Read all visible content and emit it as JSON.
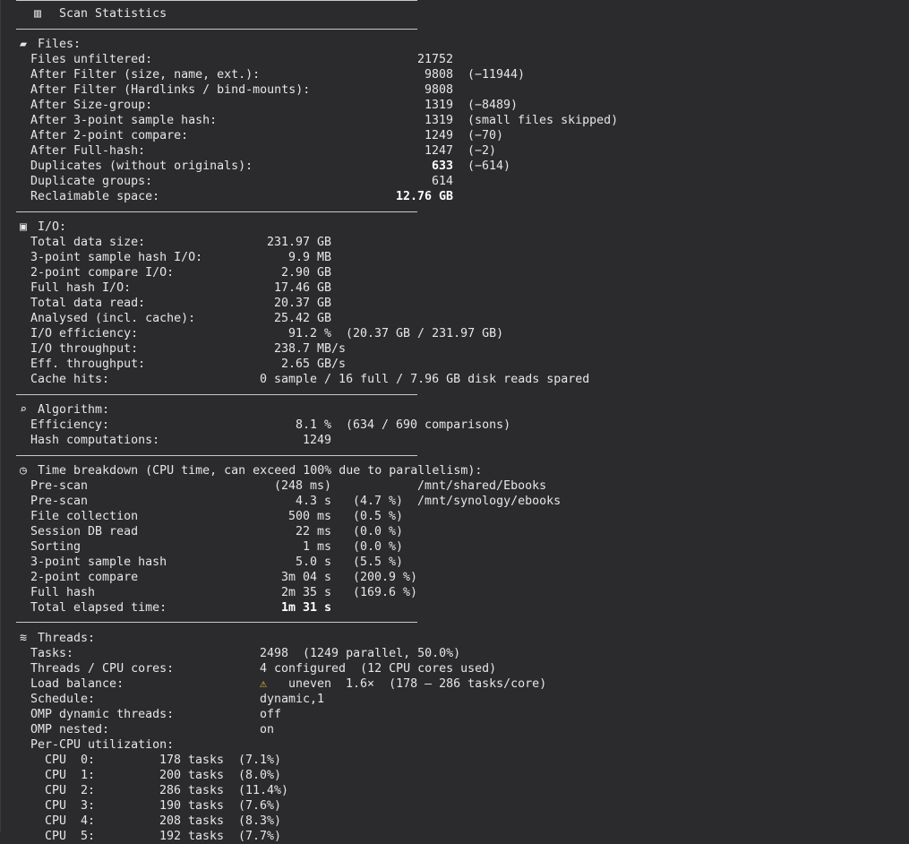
{
  "title": "Scan Statistics",
  "icons": {
    "title": "bar-chart-icon",
    "files": "folder-icon",
    "io": "floppy-disk-icon",
    "algorithm": "magnifier-icon",
    "time": "stopwatch-icon",
    "threads": "thread-spool-icon",
    "warning": "warning-icon"
  },
  "files": {
    "heading": "Files:",
    "rows": [
      {
        "label": "Files unfiltered:",
        "value": "21752",
        "note": ""
      },
      {
        "label": "After Filter (size, name, ext.):",
        "value": "9808",
        "note": "(−11944)"
      },
      {
        "label": "After Filter (Hardlinks / bind-mounts):",
        "value": "9808",
        "note": ""
      },
      {
        "label": "After Size-group:",
        "value": "1319",
        "note": "(−8489)"
      },
      {
        "label": "After 3-point sample hash:",
        "value": "1319",
        "note": "(small files skipped)"
      },
      {
        "label": "After 2-point compare:",
        "value": "1249",
        "note": "(−70)"
      },
      {
        "label": "After Full-hash:",
        "value": "1247",
        "note": "(−2)"
      },
      {
        "label": "Duplicates (without originals):",
        "value": "633",
        "note": "(−614)"
      },
      {
        "label": "Duplicate groups:",
        "value": "614",
        "note": ""
      },
      {
        "label": "Reclaimable space:",
        "value": "12.76 GB",
        "note": ""
      }
    ]
  },
  "io": {
    "heading": "I/O:",
    "rows": [
      {
        "label": "Total data size:",
        "value": "231.97 GB",
        "note": ""
      },
      {
        "label": "3-point sample hash I/O:",
        "value": "9.9 MB",
        "note": ""
      },
      {
        "label": "2-point compare I/O:",
        "value": "2.90 GB",
        "note": ""
      },
      {
        "label": "Full hash I/O:",
        "value": "17.46 GB",
        "note": ""
      },
      {
        "label": "Total data read:",
        "value": "20.37 GB",
        "note": ""
      },
      {
        "label": "Analysed (incl. cache):",
        "value": "25.42 GB",
        "note": ""
      },
      {
        "label": "I/O efficiency:",
        "value": "91.2 %",
        "note": "(20.37 GB / 231.97 GB)"
      },
      {
        "label": "I/O throughput:",
        "value": "238.7 MB/s",
        "note": ""
      },
      {
        "label": "Eff. throughput:",
        "value": "2.65 GB/s",
        "note": ""
      },
      {
        "label": "Cache hits:",
        "value": "0 sample / 16 full / 7.96 GB disk reads spared",
        "note": ""
      }
    ]
  },
  "algorithm": {
    "heading": "Algorithm:",
    "rows": [
      {
        "label": "Efficiency:",
        "value": "8.1 %",
        "note": "(634 / 690 comparisons)"
      },
      {
        "label": "Hash computations:",
        "value": "1249",
        "note": ""
      }
    ]
  },
  "time": {
    "heading": "Time breakdown (CPU time, can exceed 100% due to parallelism):",
    "rows": [
      {
        "label": "Pre-scan",
        "value": "(248 ms)",
        "note": "/mnt/shared/Ebooks"
      },
      {
        "label": "Pre-scan",
        "value": "4.3 s",
        "note": "(4.7 %)  /mnt/synology/ebooks"
      },
      {
        "label": "File collection",
        "value": "500 ms",
        "note": "(0.5 %)"
      },
      {
        "label": "Session DB read",
        "value": "22 ms",
        "note": "(0.0 %)"
      },
      {
        "label": "Sorting",
        "value": "1 ms",
        "note": "(0.0 %)"
      },
      {
        "label": "3-point sample hash",
        "value": "5.0 s",
        "note": "(5.5 %)"
      },
      {
        "label": "2-point compare",
        "value": "3m 04 s",
        "note": "(200.9 %)"
      },
      {
        "label": "Full hash",
        "value": "2m 35 s",
        "note": "(169.6 %)"
      },
      {
        "label": "Total elapsed time:",
        "value": "1m 31 s",
        "note": ""
      }
    ]
  },
  "threads": {
    "heading": "Threads:",
    "rows": [
      {
        "label": "Tasks:",
        "value": "2498  (1249 parallel, 50.0%)"
      },
      {
        "label": "Threads / CPU cores:",
        "value": "4 configured  (12 CPU cores used)"
      },
      {
        "label": "Load balance:",
        "value": "uneven  1.6×  (178 – 286 tasks/core)"
      },
      {
        "label": "Schedule:",
        "value": "dynamic,1"
      },
      {
        "label": "OMP dynamic threads:",
        "value": "off"
      },
      {
        "label": "OMP nested:",
        "value": "on"
      },
      {
        "label": "Per-CPU utilization:",
        "value": ""
      }
    ],
    "cpus": [
      {
        "label": "CPU  0:",
        "value": "178 tasks",
        "note": "(7.1%)"
      },
      {
        "label": "CPU  1:",
        "value": "200 tasks",
        "note": "(8.0%)"
      },
      {
        "label": "CPU  2:",
        "value": "286 tasks",
        "note": "(11.4%)"
      },
      {
        "label": "CPU  3:",
        "value": "190 tasks",
        "note": "(7.6%)"
      },
      {
        "label": "CPU  4:",
        "value": "208 tasks",
        "note": "(8.3%)"
      },
      {
        "label": "CPU  5:",
        "value": "192 tasks",
        "note": "(7.7%)"
      }
    ]
  }
}
